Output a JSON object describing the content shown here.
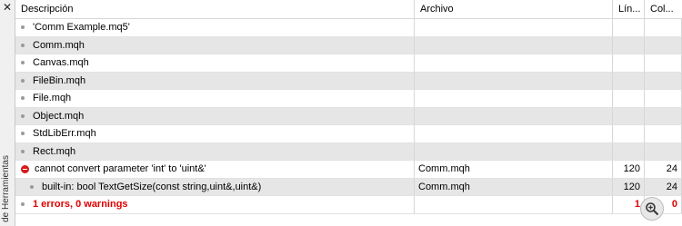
{
  "sidebar": {
    "close_glyph": "✕",
    "title": "de Herramientas"
  },
  "table": {
    "columns": [
      "Descripción",
      "Archivo",
      "Lín...",
      "Col..."
    ],
    "rows": [
      {
        "description": "'Comm Example.mq5'",
        "file": "",
        "line": "",
        "col": ""
      },
      {
        "description": "Comm.mqh",
        "file": "",
        "line": "",
        "col": ""
      },
      {
        "description": "Canvas.mqh",
        "file": "",
        "line": "",
        "col": ""
      },
      {
        "description": "FileBin.mqh",
        "file": "",
        "line": "",
        "col": ""
      },
      {
        "description": "File.mqh",
        "file": "",
        "line": "",
        "col": ""
      },
      {
        "description": "Object.mqh",
        "file": "",
        "line": "",
        "col": ""
      },
      {
        "description": "StdLibErr.mqh",
        "file": "",
        "line": "",
        "col": ""
      },
      {
        "description": "Rect.mqh",
        "file": "",
        "line": "",
        "col": ""
      },
      {
        "description": "cannot convert parameter 'int' to 'uint&'",
        "file": "Comm.mqh",
        "line": "120",
        "col": "24"
      },
      {
        "description": "built-in: bool TextGetSize(const string,uint&,uint&)",
        "file": "Comm.mqh",
        "line": "120",
        "col": "24"
      },
      {
        "description": "1 errors, 0 warnings",
        "file": "",
        "line": "1",
        "col": "0"
      }
    ]
  },
  "colors": {
    "error": "#d51b1b",
    "summary_text": "#e00000",
    "alt_row": "#e6e6e6"
  },
  "icons": {
    "error": "error-icon",
    "bullet": "bullet-icon",
    "zoom": "zoom-in-icon"
  }
}
